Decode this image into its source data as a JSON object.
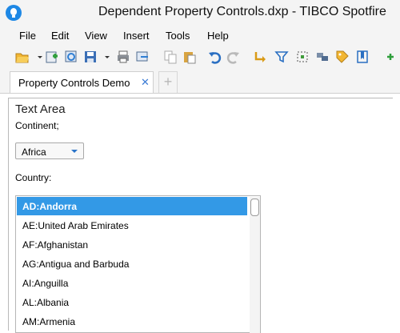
{
  "window": {
    "title": "Dependent Property Controls.dxp - TIBCO Spotfire"
  },
  "menu": [
    "File",
    "Edit",
    "View",
    "Insert",
    "Tools",
    "Help"
  ],
  "toolbar": {
    "icons": [
      "open-folder-icon",
      "new-page-icon",
      "refresh-icon",
      "save-icon",
      "print-icon",
      "export-icon",
      "copy-icon",
      "paste-icon",
      "undo-icon",
      "redo-icon",
      "reset-filter-icon",
      "filter-icon",
      "data-panel-icon",
      "details-icon",
      "tag-icon",
      "bookmark-icon",
      "more-icon"
    ]
  },
  "tabs": [
    {
      "label": "Property Controls Demo",
      "close": "✕"
    }
  ],
  "tab_add": "+",
  "textarea": {
    "title": "Text Area",
    "continent_label": "Continent;",
    "continent_value": "Africa",
    "country_label": "Country:",
    "countries": [
      "AD:Andorra",
      "AE:United Arab Emirates",
      "AF:Afghanistan",
      "AG:Antigua and Barbuda",
      "AI:Anguilla",
      "AL:Albania",
      "AM:Armenia"
    ],
    "selected_index": 0
  },
  "colors": {
    "accent": "#3399e6",
    "app_icon": "#1e88e5"
  }
}
